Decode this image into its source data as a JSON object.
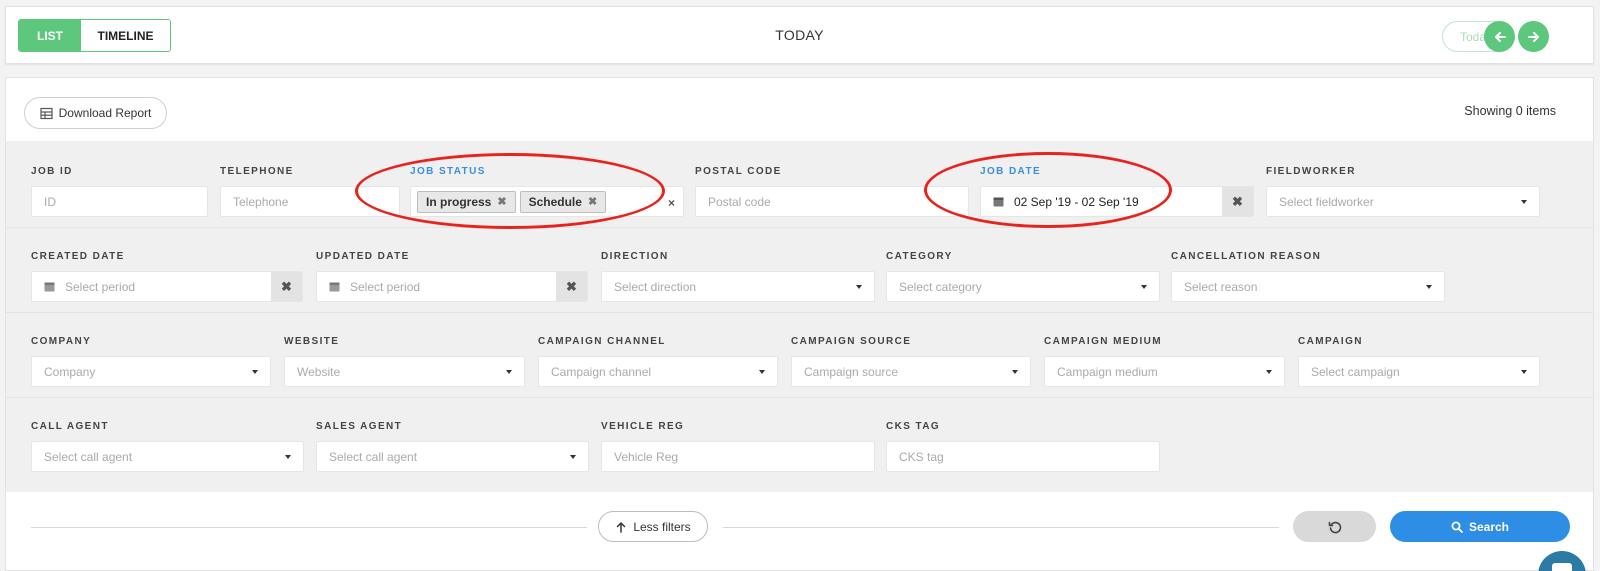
{
  "header": {
    "tabs": [
      {
        "label": "LIST",
        "active": true
      },
      {
        "label": "TIMELINE",
        "active": false
      }
    ],
    "title": "TODAY",
    "today_button": "Today",
    "prev_icon": "arrow-left-icon",
    "next_icon": "arrow-right-icon"
  },
  "toolbar": {
    "download_label": "Download Report",
    "download_icon": "table-icon",
    "showing_text": "Showing 0 items"
  },
  "filters": {
    "job_id": {
      "label": "JOB ID",
      "placeholder": "ID"
    },
    "telephone": {
      "label": "TELEPHONE",
      "placeholder": "Telephone"
    },
    "job_status": {
      "label": "JOB STATUS",
      "tags": [
        "In progress",
        "Schedule"
      ],
      "clear": "×"
    },
    "postal_code": {
      "label": "POSTAL CODE",
      "placeholder": "Postal code"
    },
    "job_date": {
      "label": "JOB DATE",
      "value": "02 Sep '19 - 02 Sep '19"
    },
    "fieldworker": {
      "label": "FIELDWORKER",
      "placeholder": "Select fieldworker"
    },
    "created_date": {
      "label": "CREATED DATE",
      "placeholder": "Select period"
    },
    "updated_date": {
      "label": "UPDATED DATE",
      "placeholder": "Select period"
    },
    "direction": {
      "label": "DIRECTION",
      "placeholder": "Select direction"
    },
    "category": {
      "label": "CATEGORY",
      "placeholder": "Select category"
    },
    "cancellation_reason": {
      "label": "CANCELLATION REASON",
      "placeholder": "Select reason"
    },
    "company": {
      "label": "COMPANY",
      "placeholder": "Company"
    },
    "website": {
      "label": "WEBSITE",
      "placeholder": "Website"
    },
    "campaign_channel": {
      "label": "CAMPAIGN CHANNEL",
      "placeholder": "Campaign channel"
    },
    "campaign_source": {
      "label": "CAMPAIGN SOURCE",
      "placeholder": "Campaign source"
    },
    "campaign_medium": {
      "label": "CAMPAIGN MEDIUM",
      "placeholder": "Campaign medium"
    },
    "campaign": {
      "label": "CAMPAIGN",
      "placeholder": "Select campaign"
    },
    "call_agent": {
      "label": "CALL AGENT",
      "placeholder": "Select call agent"
    },
    "sales_agent": {
      "label": "SALES AGENT",
      "placeholder": "Select call agent"
    },
    "vehicle_reg": {
      "label": "VEHICLE REG",
      "placeholder": "Vehicle Reg"
    },
    "cks_tag": {
      "label": "CKS TAG",
      "placeholder": "CKS tag"
    }
  },
  "actions": {
    "less_filters": "Less filters",
    "search": "Search"
  },
  "colors": {
    "green": "#5cc77d",
    "blue": "#2e8de4",
    "annotation": "#e8231e"
  }
}
